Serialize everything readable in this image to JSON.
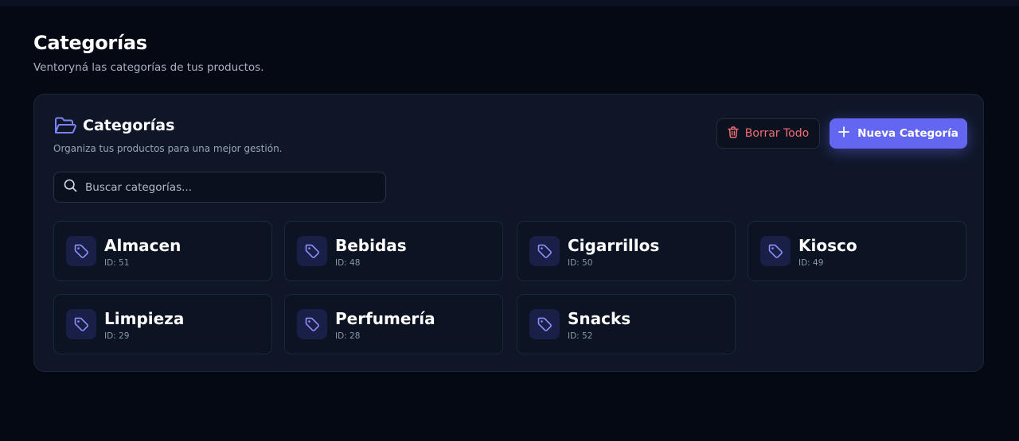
{
  "header": {
    "title": "Categorías",
    "subtitle": "Ventoryná las categorías de tus productos."
  },
  "panel": {
    "title": "Categorías",
    "subtitle": "Organiza tus productos para una mejor gestión.",
    "icon": "folder-open-icon",
    "delete_all_label": "Borrar Todo",
    "delete_icon": "trash-icon",
    "new_category_label": "Nueva Categoría",
    "new_icon": "plus-icon"
  },
  "search": {
    "placeholder": "Buscar categorías...",
    "value": "",
    "icon": "search-icon"
  },
  "categories": [
    {
      "name": "Almacen",
      "id": "ID: 51"
    },
    {
      "name": "Bebidas",
      "id": "ID: 48"
    },
    {
      "name": "Cigarrillos",
      "id": "ID: 50"
    },
    {
      "name": "Kiosco",
      "id": "ID: 49"
    },
    {
      "name": "Limpieza",
      "id": "ID: 29"
    },
    {
      "name": "Perfumería",
      "id": "ID: 28"
    },
    {
      "name": "Snacks",
      "id": "ID: 52"
    }
  ],
  "colors": {
    "accent": "#6366f1",
    "danger": "#f06d73",
    "background": "#050914",
    "card": "#0f1627"
  }
}
